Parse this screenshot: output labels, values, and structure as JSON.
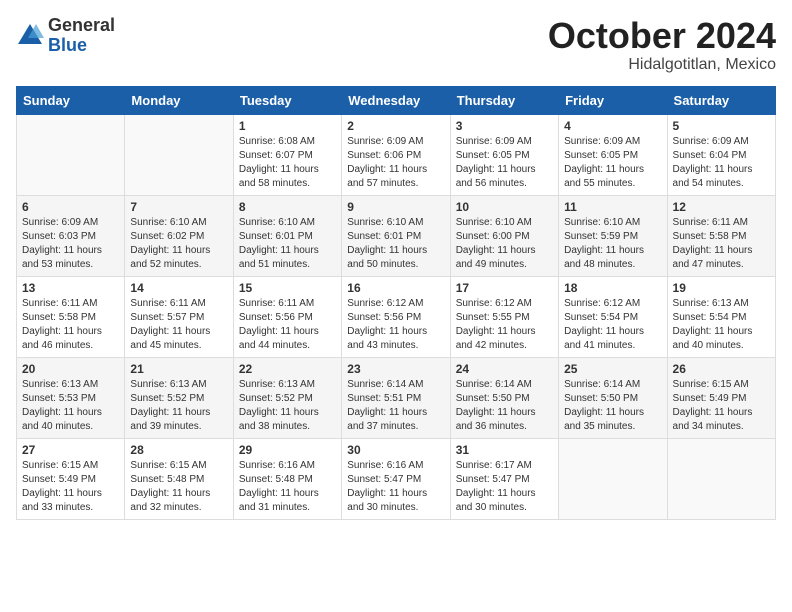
{
  "logo": {
    "general": "General",
    "blue": "Blue"
  },
  "title": "October 2024",
  "location": "Hidalgotitlan, Mexico",
  "weekdays": [
    "Sunday",
    "Monday",
    "Tuesday",
    "Wednesday",
    "Thursday",
    "Friday",
    "Saturday"
  ],
  "weeks": [
    [
      {
        "day": "",
        "content": ""
      },
      {
        "day": "",
        "content": ""
      },
      {
        "day": "1",
        "content": "Sunrise: 6:08 AM\nSunset: 6:07 PM\nDaylight: 11 hours and 58 minutes."
      },
      {
        "day": "2",
        "content": "Sunrise: 6:09 AM\nSunset: 6:06 PM\nDaylight: 11 hours and 57 minutes."
      },
      {
        "day": "3",
        "content": "Sunrise: 6:09 AM\nSunset: 6:05 PM\nDaylight: 11 hours and 56 minutes."
      },
      {
        "day": "4",
        "content": "Sunrise: 6:09 AM\nSunset: 6:05 PM\nDaylight: 11 hours and 55 minutes."
      },
      {
        "day": "5",
        "content": "Sunrise: 6:09 AM\nSunset: 6:04 PM\nDaylight: 11 hours and 54 minutes."
      }
    ],
    [
      {
        "day": "6",
        "content": "Sunrise: 6:09 AM\nSunset: 6:03 PM\nDaylight: 11 hours and 53 minutes."
      },
      {
        "day": "7",
        "content": "Sunrise: 6:10 AM\nSunset: 6:02 PM\nDaylight: 11 hours and 52 minutes."
      },
      {
        "day": "8",
        "content": "Sunrise: 6:10 AM\nSunset: 6:01 PM\nDaylight: 11 hours and 51 minutes."
      },
      {
        "day": "9",
        "content": "Sunrise: 6:10 AM\nSunset: 6:01 PM\nDaylight: 11 hours and 50 minutes."
      },
      {
        "day": "10",
        "content": "Sunrise: 6:10 AM\nSunset: 6:00 PM\nDaylight: 11 hours and 49 minutes."
      },
      {
        "day": "11",
        "content": "Sunrise: 6:10 AM\nSunset: 5:59 PM\nDaylight: 11 hours and 48 minutes."
      },
      {
        "day": "12",
        "content": "Sunrise: 6:11 AM\nSunset: 5:58 PM\nDaylight: 11 hours and 47 minutes."
      }
    ],
    [
      {
        "day": "13",
        "content": "Sunrise: 6:11 AM\nSunset: 5:58 PM\nDaylight: 11 hours and 46 minutes."
      },
      {
        "day": "14",
        "content": "Sunrise: 6:11 AM\nSunset: 5:57 PM\nDaylight: 11 hours and 45 minutes."
      },
      {
        "day": "15",
        "content": "Sunrise: 6:11 AM\nSunset: 5:56 PM\nDaylight: 11 hours and 44 minutes."
      },
      {
        "day": "16",
        "content": "Sunrise: 6:12 AM\nSunset: 5:56 PM\nDaylight: 11 hours and 43 minutes."
      },
      {
        "day": "17",
        "content": "Sunrise: 6:12 AM\nSunset: 5:55 PM\nDaylight: 11 hours and 42 minutes."
      },
      {
        "day": "18",
        "content": "Sunrise: 6:12 AM\nSunset: 5:54 PM\nDaylight: 11 hours and 41 minutes."
      },
      {
        "day": "19",
        "content": "Sunrise: 6:13 AM\nSunset: 5:54 PM\nDaylight: 11 hours and 40 minutes."
      }
    ],
    [
      {
        "day": "20",
        "content": "Sunrise: 6:13 AM\nSunset: 5:53 PM\nDaylight: 11 hours and 40 minutes."
      },
      {
        "day": "21",
        "content": "Sunrise: 6:13 AM\nSunset: 5:52 PM\nDaylight: 11 hours and 39 minutes."
      },
      {
        "day": "22",
        "content": "Sunrise: 6:13 AM\nSunset: 5:52 PM\nDaylight: 11 hours and 38 minutes."
      },
      {
        "day": "23",
        "content": "Sunrise: 6:14 AM\nSunset: 5:51 PM\nDaylight: 11 hours and 37 minutes."
      },
      {
        "day": "24",
        "content": "Sunrise: 6:14 AM\nSunset: 5:50 PM\nDaylight: 11 hours and 36 minutes."
      },
      {
        "day": "25",
        "content": "Sunrise: 6:14 AM\nSunset: 5:50 PM\nDaylight: 11 hours and 35 minutes."
      },
      {
        "day": "26",
        "content": "Sunrise: 6:15 AM\nSunset: 5:49 PM\nDaylight: 11 hours and 34 minutes."
      }
    ],
    [
      {
        "day": "27",
        "content": "Sunrise: 6:15 AM\nSunset: 5:49 PM\nDaylight: 11 hours and 33 minutes."
      },
      {
        "day": "28",
        "content": "Sunrise: 6:15 AM\nSunset: 5:48 PM\nDaylight: 11 hours and 32 minutes."
      },
      {
        "day": "29",
        "content": "Sunrise: 6:16 AM\nSunset: 5:48 PM\nDaylight: 11 hours and 31 minutes."
      },
      {
        "day": "30",
        "content": "Sunrise: 6:16 AM\nSunset: 5:47 PM\nDaylight: 11 hours and 30 minutes."
      },
      {
        "day": "31",
        "content": "Sunrise: 6:17 AM\nSunset: 5:47 PM\nDaylight: 11 hours and 30 minutes."
      },
      {
        "day": "",
        "content": ""
      },
      {
        "day": "",
        "content": ""
      }
    ]
  ]
}
